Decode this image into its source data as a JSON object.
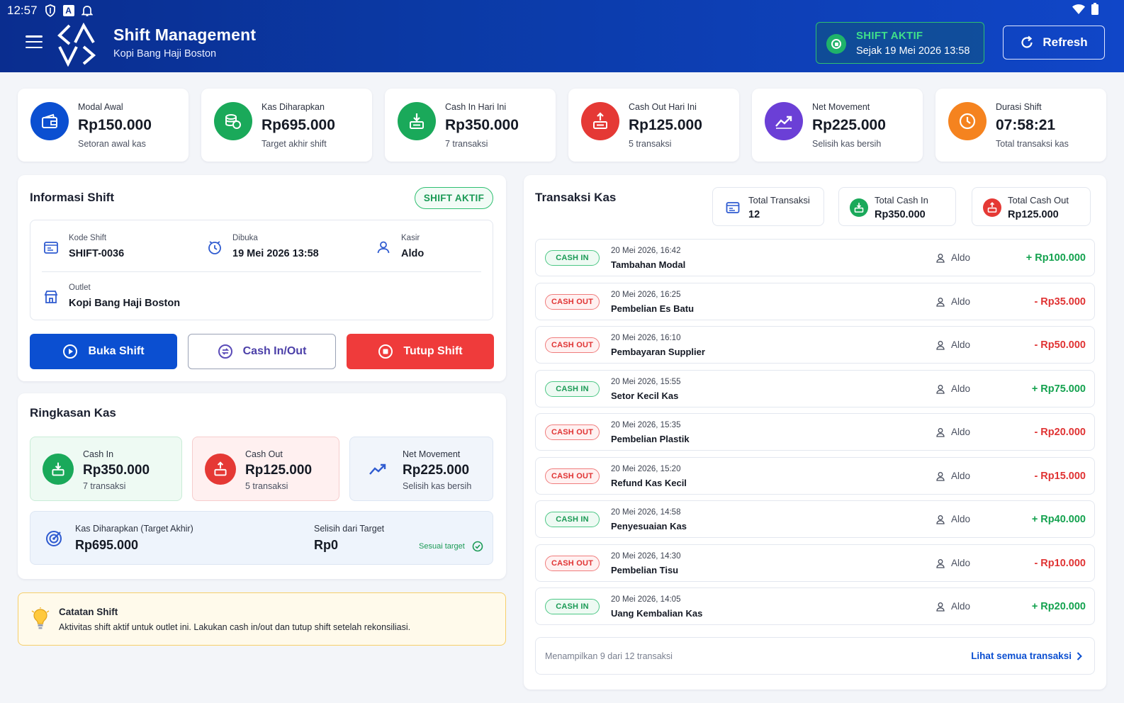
{
  "statusbar": {
    "time": "12:57",
    "letter": "A"
  },
  "header": {
    "title": "Shift Management",
    "subtitle": "Kopi Bang Haji Boston",
    "shift_status": "SHIFT AKTIF",
    "shift_since": "Sejak 19 Mei 2026 13:58",
    "refresh_label": "Refresh"
  },
  "stats": [
    {
      "label": "Modal Awal",
      "value": "Rp150.000",
      "sub": "Setoran awal kas",
      "icon": "wallet-icon",
      "color": "#0b4fd1"
    },
    {
      "label": "Kas Diharapkan",
      "value": "Rp695.000",
      "sub": "Target akhir shift",
      "icon": "coins-icon",
      "color": "#1aa95a"
    },
    {
      "label": "Cash In Hari Ini",
      "value": "Rp350.000",
      "sub": "7 transaksi",
      "icon": "cash-in-icon",
      "color": "#1aa95a"
    },
    {
      "label": "Cash Out Hari Ini",
      "value": "Rp125.000",
      "sub": "5 transaksi",
      "icon": "cash-out-icon",
      "color": "#e53935"
    },
    {
      "label": "Net Movement",
      "value": "Rp225.000",
      "sub": "Selisih kas bersih",
      "icon": "trend-up-icon",
      "color": "#6b3fd6"
    },
    {
      "label": "Durasi Shift",
      "value": "07:58:21",
      "sub": "Total transaksi kas",
      "icon": "clock-icon",
      "color": "#f5831f"
    }
  ],
  "shift_info": {
    "title": "Informasi Shift",
    "badge": "SHIFT AKTIF",
    "kode_label": "Kode Shift",
    "kode_value": "SHIFT-0036",
    "dibuka_label": "Dibuka",
    "dibuka_value": "19 Mei 2026 13:58",
    "kasir_label": "Kasir",
    "kasir_value": "Aldo",
    "outlet_label": "Outlet",
    "outlet_value": "Kopi Bang Haji Boston",
    "btn_open": "Buka Shift",
    "btn_cash": "Cash In/Out",
    "btn_close": "Tutup Shift"
  },
  "summary": {
    "title": "Ringkasan Kas",
    "cash_in_label": "Cash In",
    "cash_in_value": "Rp350.000",
    "cash_in_sub": "7 transaksi",
    "cash_out_label": "Cash Out",
    "cash_out_value": "Rp125.000",
    "cash_out_sub": "5 transaksi",
    "net_label": "Net Movement",
    "net_value": "Rp225.000",
    "net_sub": "Selisih kas bersih",
    "target_label": "Kas Diharapkan (Target Akhir)",
    "target_value": "Rp695.000",
    "diff_label": "Selisih dari Target",
    "diff_value": "Rp0",
    "diff_status": "Sesuai target"
  },
  "note": {
    "title": "Catatan Shift",
    "text": "Aktivitas shift aktif untuk outlet ini. Lakukan cash in/out dan tutup shift setelah rekonsiliasi."
  },
  "transactions": {
    "title": "Transaksi Kas",
    "total_label": "Total Transaksi",
    "total_value": "12",
    "total_in_label": "Total Cash In",
    "total_in_value": "Rp350.000",
    "total_out_label": "Total Cash Out",
    "total_out_value": "Rp125.000",
    "rows": [
      {
        "type": "in",
        "tag": "CASH IN",
        "time": "20 Mei 2026, 16:42",
        "desc": "Tambahan Modal",
        "user": "Aldo",
        "amount": "+ Rp100.000"
      },
      {
        "type": "out",
        "tag": "CASH OUT",
        "time": "20 Mei 2026, 16:25",
        "desc": "Pembelian Es Batu",
        "user": "Aldo",
        "amount": "- Rp35.000"
      },
      {
        "type": "out",
        "tag": "CASH OUT",
        "time": "20 Mei 2026, 16:10",
        "desc": "Pembayaran Supplier",
        "user": "Aldo",
        "amount": "- Rp50.000"
      },
      {
        "type": "in",
        "tag": "CASH IN",
        "time": "20 Mei 2026, 15:55",
        "desc": "Setor Kecil Kas",
        "user": "Aldo",
        "amount": "+ Rp75.000"
      },
      {
        "type": "out",
        "tag": "CASH OUT",
        "time": "20 Mei 2026, 15:35",
        "desc": "Pembelian Plastik",
        "user": "Aldo",
        "amount": "- Rp20.000"
      },
      {
        "type": "out",
        "tag": "CASH OUT",
        "time": "20 Mei 2026, 15:20",
        "desc": "Refund Kas Kecil",
        "user": "Aldo",
        "amount": "- Rp15.000"
      },
      {
        "type": "in",
        "tag": "CASH IN",
        "time": "20 Mei 2026, 14:58",
        "desc": "Penyesuaian Kas",
        "user": "Aldo",
        "amount": "+ Rp40.000"
      },
      {
        "type": "out",
        "tag": "CASH OUT",
        "time": "20 Mei 2026, 14:30",
        "desc": "Pembelian Tisu",
        "user": "Aldo",
        "amount": "- Rp10.000"
      },
      {
        "type": "in",
        "tag": "CASH IN",
        "time": "20 Mei 2026, 14:05",
        "desc": "Uang Kembalian Kas",
        "user": "Aldo",
        "amount": "+ Rp20.000"
      }
    ],
    "footer_text": "Menampilkan 9 dari 12 transaksi",
    "footer_link": "Lihat semua transaksi"
  }
}
